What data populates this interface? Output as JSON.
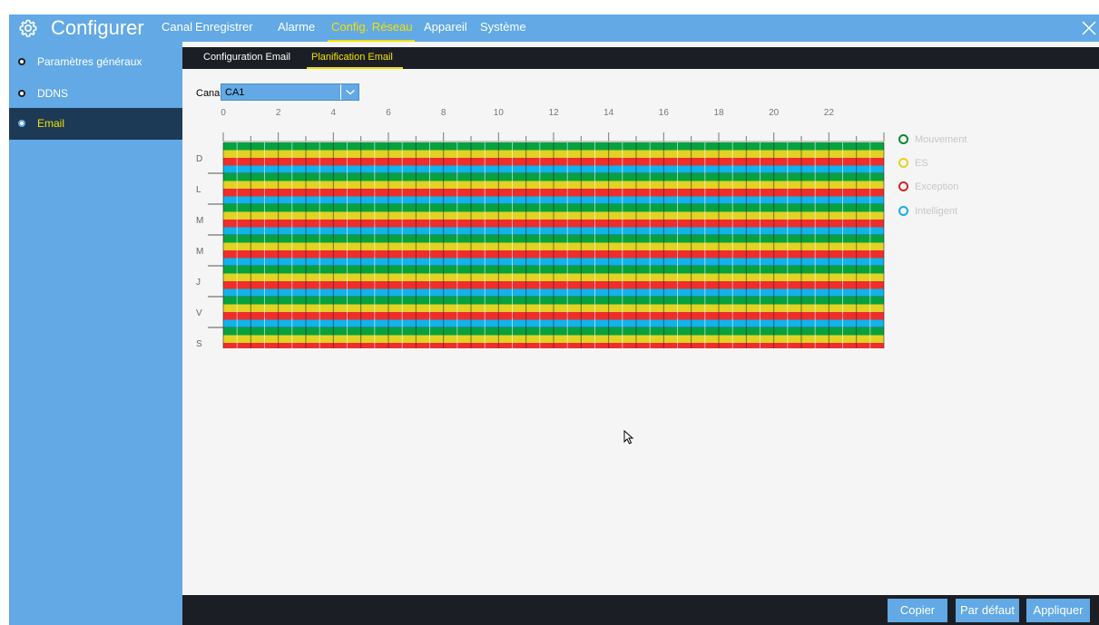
{
  "app": {
    "title": "Configurer"
  },
  "nav": {
    "tabs": [
      {
        "label": "Canal"
      },
      {
        "label": "Enregistrer"
      },
      {
        "label": "Alarme"
      },
      {
        "label": "Config. Réseau",
        "active": true
      },
      {
        "label": "Appareil"
      },
      {
        "label": "Système"
      }
    ]
  },
  "sidebar": {
    "items": [
      {
        "label": "Paramètres généraux"
      },
      {
        "label": "DDNS"
      },
      {
        "label": "Email",
        "active": true
      }
    ]
  },
  "subtabs": [
    {
      "label": "Configuration Email"
    },
    {
      "label": "Planification Email",
      "active": true
    }
  ],
  "channel": {
    "label": "Canal",
    "value": "CA1"
  },
  "schedule": {
    "hour_labels": [
      "0",
      "2",
      "4",
      "6",
      "8",
      "10",
      "12",
      "14",
      "16",
      "18",
      "20",
      "22"
    ],
    "days": [
      "D",
      "L",
      "M",
      "M",
      "J",
      "V",
      "S"
    ],
    "row_colors": [
      "#05a23e",
      "#e1d224",
      "#ef2d2d",
      "#0eb4ec"
    ]
  },
  "legend": [
    {
      "label": "Mouvement",
      "color": "#0c8a2f"
    },
    {
      "label": "ES",
      "color": "#e6d21c"
    },
    {
      "label": "Exception",
      "color": "#d42424"
    },
    {
      "label": "Intelligent",
      "color": "#16aee8"
    }
  ],
  "buttons": {
    "copy": "Copier",
    "default": "Par défaut",
    "apply": "Appliquer"
  },
  "colors": {
    "primary": "#62a9e5",
    "accent": "#f3e000",
    "dark": "#1b1f25",
    "sidebar_active": "#1c3a56"
  }
}
